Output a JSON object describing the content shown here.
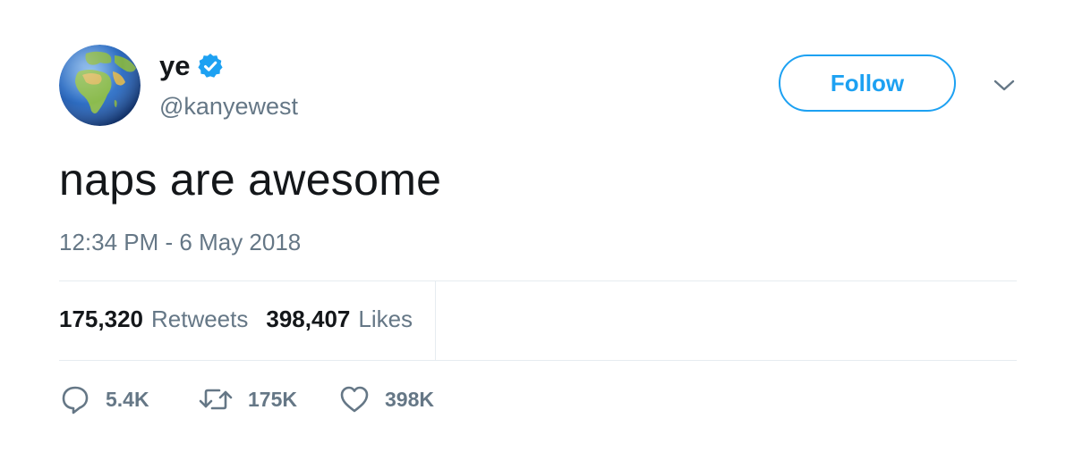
{
  "user": {
    "display_name": "ye",
    "handle": "@kanyewest",
    "verified": true,
    "avatar_icon": "globe-europe-africa-emoji"
  },
  "follow_button": {
    "label": "Follow"
  },
  "more_menu": {
    "icon": "chevron-down-icon"
  },
  "tweet": {
    "text": "naps are awesome",
    "timestamp": "12:34 PM - 6 May 2018"
  },
  "stats": {
    "retweets": {
      "count": "175,320",
      "label": "Retweets"
    },
    "likes": {
      "count": "398,407",
      "label": "Likes"
    }
  },
  "actions": {
    "reply": {
      "icon": "reply-icon",
      "count": "5.4K"
    },
    "retweet": {
      "icon": "retweet-icon",
      "count": "175K"
    },
    "like": {
      "icon": "heart-icon",
      "count": "398K"
    }
  },
  "colors": {
    "accent": "#1da1f2",
    "text_primary": "#14171a",
    "text_secondary": "#657786",
    "divider": "#e6ecf0"
  }
}
